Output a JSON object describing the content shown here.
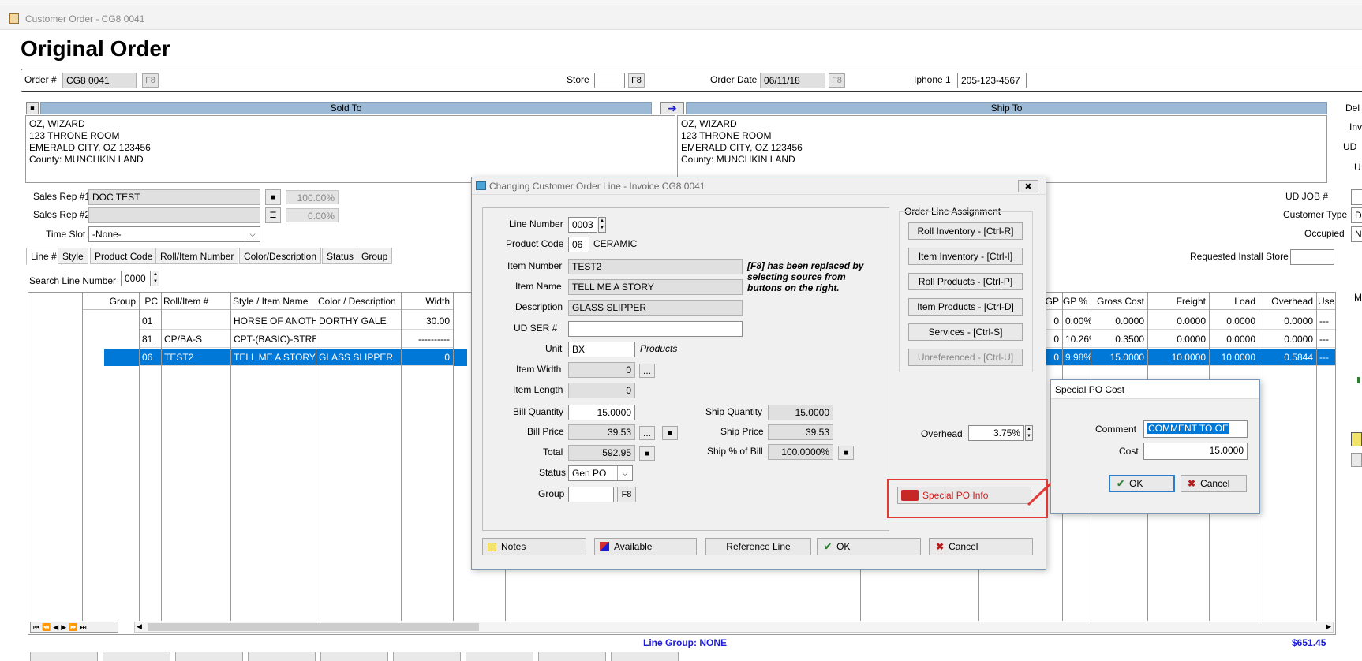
{
  "window": {
    "title": "Customer Order - CG8 0041"
  },
  "page": {
    "heading": "Original Order"
  },
  "header": {
    "order_label": "Order #",
    "order_value": "CG8 0041",
    "f8": "F8",
    "store_label": "Store",
    "store_value": "",
    "order_date_label": "Order Date",
    "order_date_value": "06/11/18",
    "iphone_label": "Iphone 1",
    "iphone_value": "205-123-4567"
  },
  "sold_to": {
    "title": "Sold To",
    "lines": [
      "OZ, WIZARD",
      "123 THRONE ROOM",
      "EMERALD CITY, OZ  123456",
      "County: MUNCHKIN LAND"
    ]
  },
  "ship_to": {
    "title": "Ship To",
    "lines": [
      "OZ, WIZARD",
      "123 THRONE ROOM",
      "EMERALD CITY, OZ  123456",
      "County: MUNCHKIN LAND"
    ]
  },
  "right_edge": {
    "del": "Del",
    "inv": "Inv",
    "ud": "UD",
    "u": "U",
    "ud_job": "UD JOB #",
    "customer_type": "Customer Type",
    "customer_type_value": "D",
    "occupied": "Occupied",
    "occupied_value": "N",
    "m": "M"
  },
  "sales": {
    "rep1_label": "Sales Rep #1",
    "rep1_value": "DOC TEST",
    "rep1_pct": "100.00%",
    "rep2_label": "Sales Rep #2",
    "rep2_value": "",
    "rep2_pct": "0.00%",
    "timeslot_label": "Time Slot",
    "timeslot_value": "-None-"
  },
  "tabs": [
    "Line #",
    "Style",
    "Product Code",
    "Roll/Item Number",
    "Color/Description",
    "Status",
    "Group"
  ],
  "search": {
    "label": "Search Line Number",
    "value": "0000"
  },
  "requested_install": {
    "label": "Requested Install Store",
    "value": ""
  },
  "grid": {
    "left_headers": [
      "Group",
      "PC",
      "Roll/Item #",
      "Style / Item Name",
      "Color / Description",
      "Width"
    ],
    "right_headers": [
      "GP",
      "GP %",
      "Gross Cost",
      "Freight",
      "Load",
      "Overhead",
      "Use"
    ],
    "rows": [
      {
        "group": "",
        "pc": "01",
        "roll": "",
        "style": "HORSE OF ANOTHE",
        "color": "DORTHY GALE",
        "width": "30.00",
        "gp": "0",
        "gp_pct": "0.00%",
        "gross": "0.0000",
        "freight": "0.0000",
        "load": "0.0000",
        "overhead": "0.0000",
        "use": "---"
      },
      {
        "group": "",
        "pc": "81",
        "roll": "CP/BA-S",
        "style": "CPT-(BASIC)-STRET",
        "color": "",
        "width": "----------",
        "gp": "0",
        "gp_pct": "10.26%",
        "gross": "0.3500",
        "freight": "0.0000",
        "load": "0.0000",
        "overhead": "0.0000",
        "use": "---"
      },
      {
        "group": "",
        "pc": "06",
        "roll": "TEST2",
        "style": "TELL ME A STORY",
        "color": "GLASS SLIPPER",
        "width": "0",
        "gp": "0",
        "gp_pct": "9.98%",
        "gross": "15.0000",
        "freight": "10.0000",
        "load": "10.0000",
        "overhead": "0.5844",
        "use": "---"
      }
    ],
    "line_group": "Line Group: NONE",
    "total": "$651.45"
  },
  "dialog": {
    "title": "Changing Customer Order Line - Invoice CG8 0041",
    "line_number_label": "Line Number",
    "line_number": "0003",
    "product_code_label": "Product Code",
    "product_code": "06",
    "product_code_desc": "CERAMIC",
    "item_number_label": "Item Number",
    "item_number": "TEST2",
    "item_name_label": "Item Name",
    "item_name": "TELL ME A STORY",
    "description_label": "Description",
    "description": "GLASS SLIPPER",
    "f8_note": "[F8] has been replaced by selecting source from buttons on the right.",
    "ud_ser_label": "UD SER #",
    "ud_ser": "",
    "unit_label": "Unit",
    "unit": "BX",
    "unit_desc": "Products",
    "item_width_label": "Item Width",
    "item_width": "0",
    "item_length_label": "Item Length",
    "item_length": "0",
    "bill_qty_label": "Bill Quantity",
    "bill_qty": "15.0000",
    "bill_price_label": "Bill Price",
    "bill_price": "39.53",
    "total_label": "Total",
    "total": "592.95",
    "status_label": "Status",
    "status": "Gen PO",
    "group_label": "Group",
    "group": "",
    "f8": "F8",
    "ship_qty_label": "Ship Quantity",
    "ship_qty": "15.0000",
    "ship_price_label": "Ship Price",
    "ship_price": "39.53",
    "ship_pct_label": "Ship % of Bill",
    "ship_pct": "100.0000%",
    "assignment_title": "Order Line Assignment",
    "assignment_buttons": [
      "Roll Inventory - [Ctrl-R]",
      "Item Inventory - [Ctrl-I]",
      "Roll Products - [Ctrl-P]",
      "Item Products - [Ctrl-D]",
      "Services - [Ctrl-S]",
      "Unreferenced - [Ctrl-U]"
    ],
    "overhead_label": "Overhead",
    "overhead": "3.75%",
    "special_po_label": "Special PO Info",
    "footer": {
      "notes": "Notes",
      "available": "Available",
      "reference": "Reference Line",
      "ok": "OK",
      "cancel": "Cancel"
    }
  },
  "special_po": {
    "title": "Special PO Cost",
    "comment_label": "Comment",
    "comment": "COMMENT TO OE",
    "cost_label": "Cost",
    "cost": "15.0000",
    "ok": "OK",
    "cancel": "Cancel"
  },
  "colors": {
    "selection": "#0078d7",
    "highlight": "#e53935",
    "panel_header": "#9cbad6",
    "link_blue": "#1c1cd6"
  }
}
